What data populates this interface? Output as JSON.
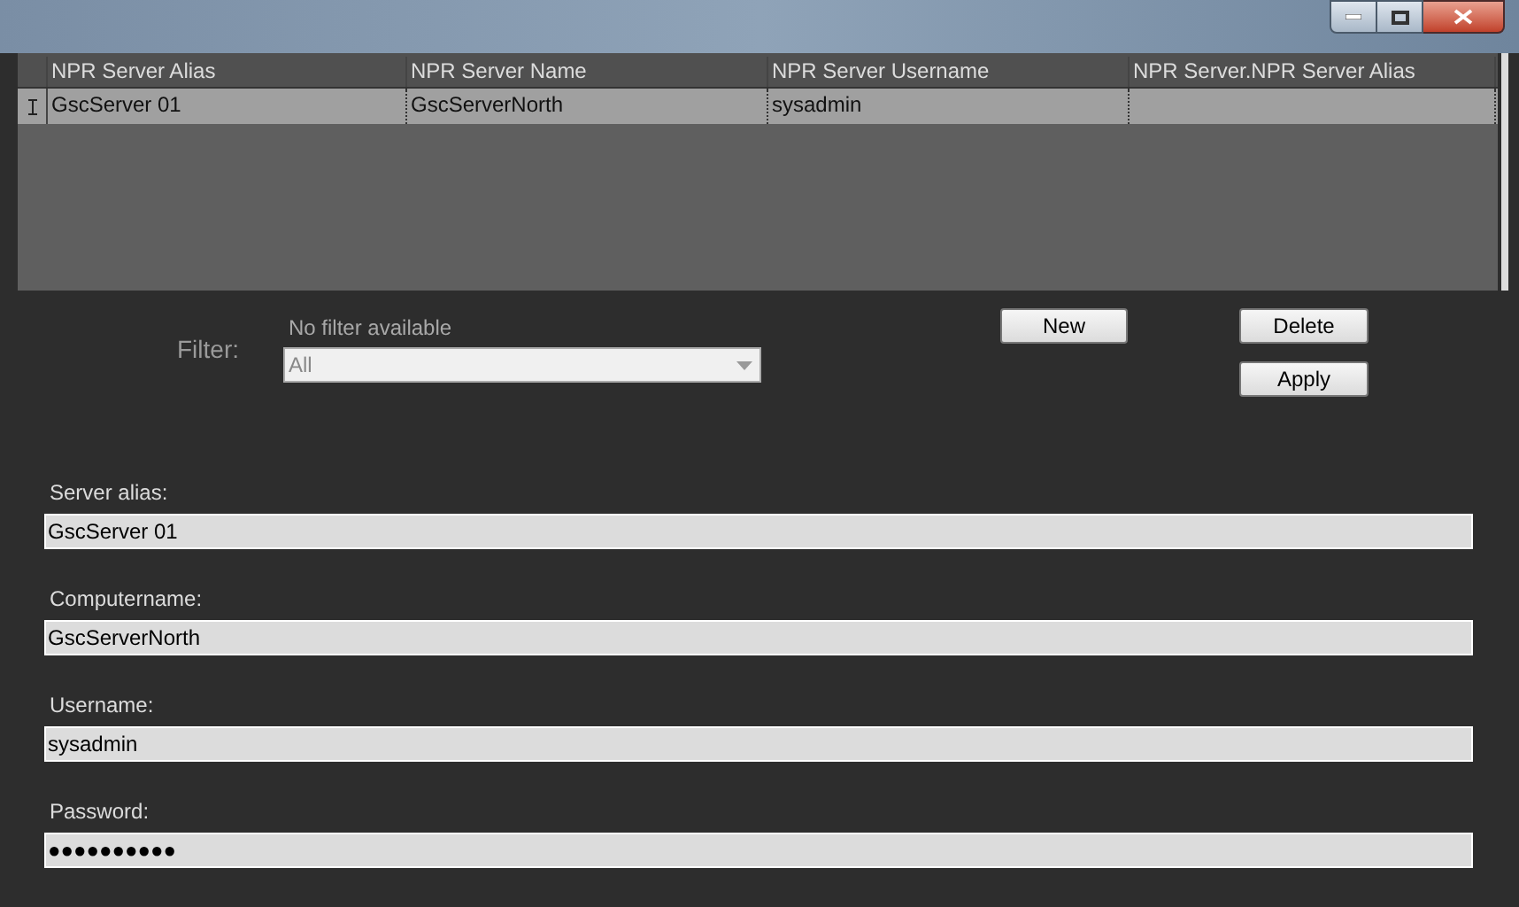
{
  "table": {
    "columns": [
      "NPR Server Alias",
      "NPR Server Name",
      "NPR Server Username",
      "NPR Server.NPR Server Alias"
    ],
    "rows": [
      {
        "cells": [
          "GscServer 01",
          "GscServerNorth",
          "sysadmin",
          ""
        ],
        "selected": true
      }
    ]
  },
  "filter": {
    "label": "Filter:",
    "hint": "No filter available",
    "value": "All",
    "disabled": true
  },
  "buttons": {
    "new": "New",
    "delete": "Delete",
    "apply": "Apply"
  },
  "fields": [
    {
      "label": "Server alias:",
      "value": "GscServer 01"
    },
    {
      "label": "Computername:",
      "value": "GscServerNorth"
    },
    {
      "label": "Username:",
      "value": "sysadmin"
    },
    {
      "label": "Password:",
      "value": "●●●●●●●●●●"
    }
  ]
}
